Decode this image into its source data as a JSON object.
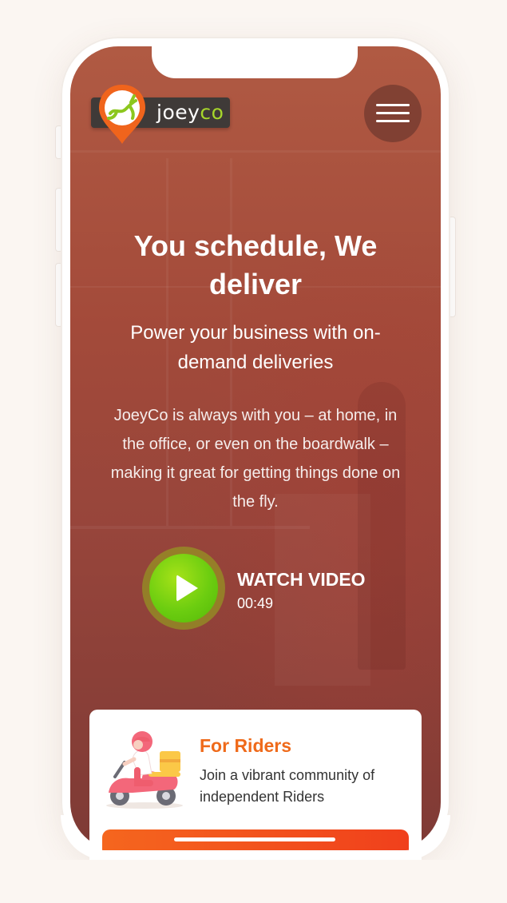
{
  "brand": {
    "logo_text_part1": "joey",
    "logo_text_part2": "co"
  },
  "header": {
    "menu_icon": "hamburger-menu-icon"
  },
  "hero": {
    "title": "You schedule, We deliver",
    "subtitle": "Power your business with on-demand deliveries",
    "body": "JoeyCo is always with you – at home, in the office, or even on the boardwalk – making it great for getting things done on the fly."
  },
  "video": {
    "label": "WATCH VIDEO",
    "duration": "00:49",
    "icon": "play-icon"
  },
  "card": {
    "title": "For Riders",
    "description": "Join a vibrant community of independent Riders",
    "illustration": "delivery-scooter-icon"
  },
  "colors": {
    "accent_orange": "#ef6a1a",
    "play_green": "#6ccd10",
    "logo_green": "#a7d62b",
    "hero_overlay": "#a34a3a"
  }
}
